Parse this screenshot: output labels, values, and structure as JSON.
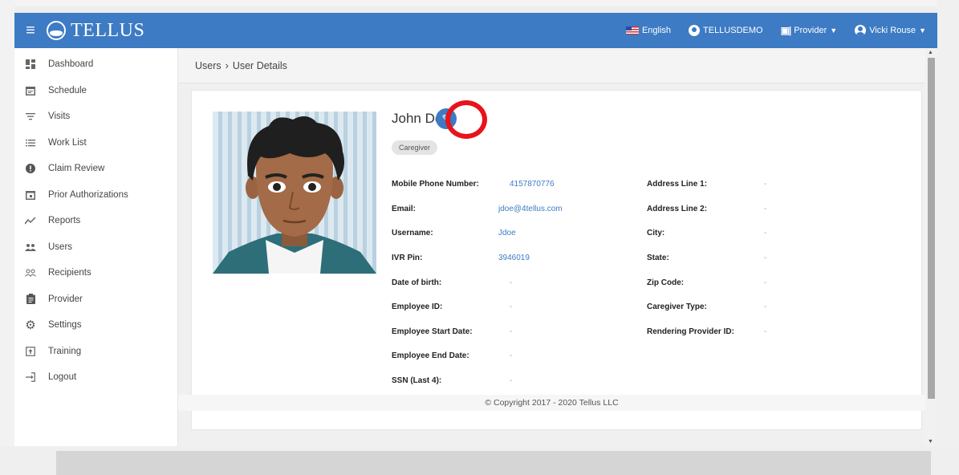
{
  "topbar": {
    "app_name": "TELLUS",
    "language": "English",
    "agency": "TELLUSDEMO",
    "role": "Provider",
    "user_name": "Vicki Rouse",
    "brand_color": "#3d7bc4"
  },
  "sidebar": {
    "items": [
      {
        "label": "Dashboard",
        "icon": "dashboard-icon"
      },
      {
        "label": "Schedule",
        "icon": "calendar-icon"
      },
      {
        "label": "Visits",
        "icon": "filter-lines-icon"
      },
      {
        "label": "Work List",
        "icon": "list-icon"
      },
      {
        "label": "Claim Review",
        "icon": "alert-circle-icon"
      },
      {
        "label": "Prior Authorizations",
        "icon": "calendar-check-icon"
      },
      {
        "label": "Reports",
        "icon": "trend-line-icon"
      },
      {
        "label": "Users",
        "icon": "group-icon"
      },
      {
        "label": "Recipients",
        "icon": "people-outline-icon"
      },
      {
        "label": "Provider",
        "icon": "clipboard-icon"
      },
      {
        "label": "Settings",
        "icon": "gear-icon"
      },
      {
        "label": "Training",
        "icon": "upload-box-icon"
      },
      {
        "label": "Logout",
        "icon": "logout-icon"
      }
    ]
  },
  "breadcrumb": {
    "parent": "Users",
    "separator": "›",
    "current": "User Details"
  },
  "user": {
    "name": "John Doe",
    "role_badge": "Caregiver"
  },
  "details_left": [
    {
      "label": "Mobile Phone Number:",
      "value": "4157870776"
    },
    {
      "label": "Email:",
      "value": "jdoe@4tellus.com"
    },
    {
      "label": "Username:",
      "value": "Jdoe"
    },
    {
      "label": "IVR Pin:",
      "value": "3946019"
    },
    {
      "label": "Date of birth:",
      "value": "-"
    },
    {
      "label": "Employee ID:",
      "value": "-"
    },
    {
      "label": "Employee Start Date:",
      "value": "-"
    },
    {
      "label": "Employee End Date:",
      "value": "-"
    },
    {
      "label": "SSN (Last 4):",
      "value": "-"
    }
  ],
  "details_right": [
    {
      "label": "Address Line 1:",
      "value": "-"
    },
    {
      "label": "Address Line 2:",
      "value": "-"
    },
    {
      "label": "City:",
      "value": "-"
    },
    {
      "label": "State:",
      "value": "-"
    },
    {
      "label": "Zip Code:",
      "value": "-"
    },
    {
      "label": "Caregiver Type:",
      "value": "-"
    },
    {
      "label": "Rendering Provider ID:",
      "value": "-"
    }
  ],
  "footer": {
    "copyright": "© Copyright 2017 - 2020 Tellus LLC"
  },
  "annotation_color": "#e8141b"
}
